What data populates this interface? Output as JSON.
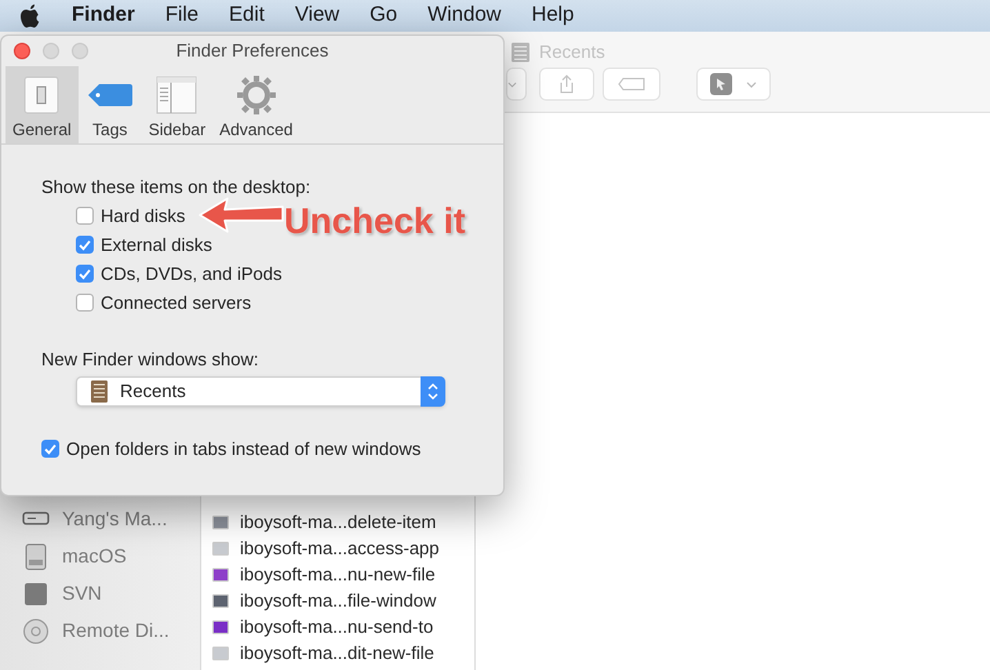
{
  "menu_bar": {
    "app_name": "Finder",
    "menus": [
      "File",
      "Edit",
      "View",
      "Go",
      "Window",
      "Help"
    ]
  },
  "finder_window": {
    "title": "Recents",
    "sidebar": [
      {
        "label": "Yang's Ma...",
        "kind": "computer"
      },
      {
        "label": "macOS",
        "kind": "disk"
      },
      {
        "label": "SVN",
        "kind": "volume"
      },
      {
        "label": "Remote Di...",
        "kind": "disc"
      }
    ],
    "files": [
      {
        "name": "iboysoft-ma...delete-item",
        "color": "#8a8f99"
      },
      {
        "name": "iboysoft-ma...access-app",
        "color": "#c8cbd0"
      },
      {
        "name": "iboysoft-ma...nu-new-file",
        "color": "#8e3fc9"
      },
      {
        "name": "iboysoft-ma...file-window",
        "color": "#5d6370"
      },
      {
        "name": "iboysoft-ma...nu-send-to",
        "color": "#7a2fc6"
      },
      {
        "name": "iboysoft-ma...dit-new-file",
        "color": "#c8cbd0"
      }
    ]
  },
  "preferences": {
    "title": "Finder Preferences",
    "tabs": [
      {
        "label": "General",
        "kind": "general",
        "selected": true
      },
      {
        "label": "Tags",
        "kind": "tags",
        "selected": false
      },
      {
        "label": "Sidebar",
        "kind": "sidebar",
        "selected": false
      },
      {
        "label": "Advanced",
        "kind": "advanced",
        "selected": false
      }
    ],
    "desktop_heading": "Show these items on the desktop:",
    "desktop_items": [
      {
        "label": "Hard disks",
        "checked": false
      },
      {
        "label": "External disks",
        "checked": true
      },
      {
        "label": "CDs, DVDs, and iPods",
        "checked": true
      },
      {
        "label": "Connected servers",
        "checked": false
      }
    ],
    "new_window_label": "New Finder windows show:",
    "new_window_value": "Recents",
    "open_in_tabs": {
      "label": "Open folders in tabs instead of new windows",
      "checked": true
    }
  },
  "annotation": {
    "text": "Uncheck it"
  }
}
